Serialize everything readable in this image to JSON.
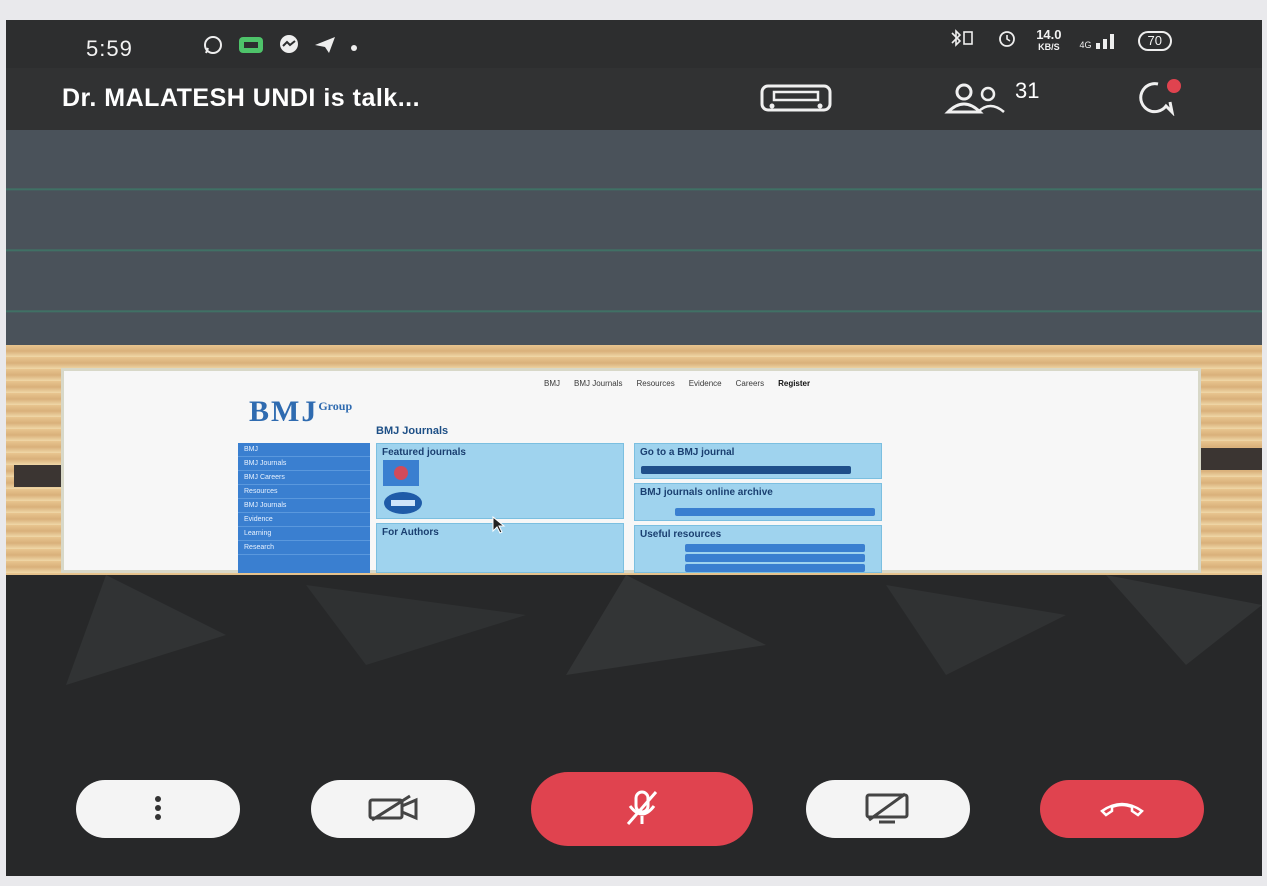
{
  "status_bar": {
    "time": "5:59",
    "net_speed_value": "14.0",
    "net_speed_unit": "KB/S",
    "network_type": "4G",
    "battery": "70"
  },
  "call_header": {
    "title": "Dr. MALATESH UNDI is talk...",
    "participants_count": "31"
  },
  "shared_screen": {
    "logo": "BMJ",
    "logo_suffix": "Group",
    "heading": "BMJ Journals",
    "top_tabs": [
      "BMJ",
      "BMJ Journals",
      "Resources",
      "Evidence",
      "Careers",
      "Register"
    ],
    "featured_panel_title": "Featured journals",
    "authors_panel_title": "For Authors",
    "go_panel_title": "Go to a BMJ journal",
    "alerts_panel_title": "BMJ journals online archive",
    "resources_panel_title": "Useful resources",
    "sidebar_items": [
      "BMJ",
      "BMJ Journals",
      "BMJ Careers",
      "Resources",
      "BMJ Journals",
      "Evidence",
      "Learning",
      "Research"
    ]
  },
  "controls": {
    "more_label": "More options",
    "video_label": "Video off",
    "mic_label": "Mute",
    "share_label": "Stop sharing",
    "end_label": "End call"
  },
  "colors": {
    "end_call": "#e0434f",
    "mic_muted": "#e0434f",
    "control_bg": "#f4f4f4"
  }
}
